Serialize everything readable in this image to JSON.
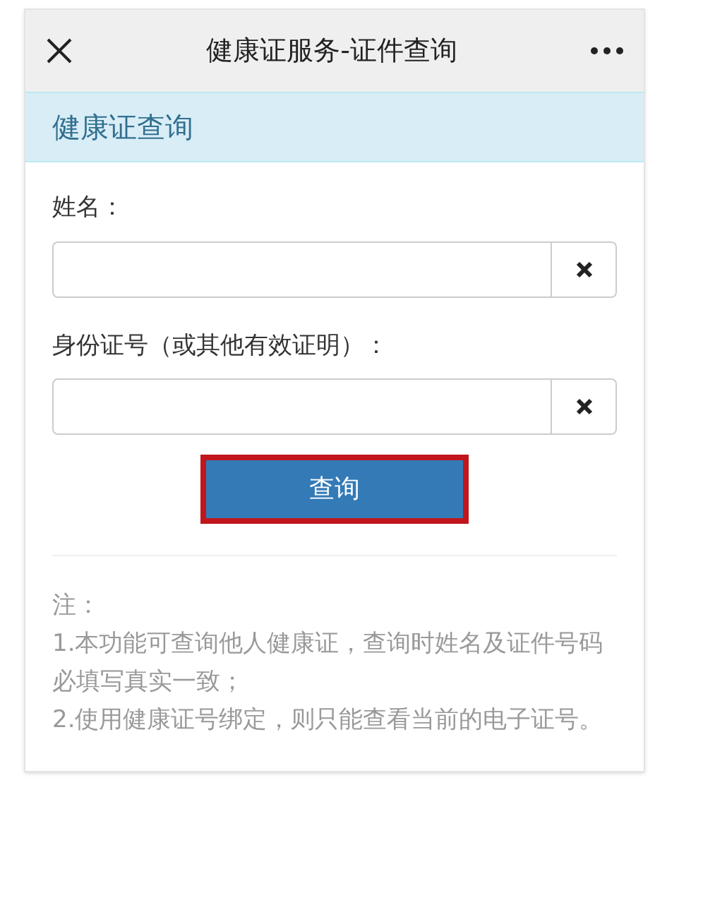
{
  "top_bar": {
    "title": "健康证服务-证件查询"
  },
  "panel": {
    "heading": "健康证查询",
    "fields": [
      {
        "label": "姓名："
      },
      {
        "label": "身份证号（或其他有效证明）："
      }
    ],
    "query_button": {
      "label": "查询",
      "highlighted": true
    },
    "notes": [
      "注：",
      "1.本功能可查询他人健康证，查询时姓名及证件号码必填写真实一致；",
      "2.使用健康证号绑定，则只能查看当前的电子证号。"
    ]
  }
}
